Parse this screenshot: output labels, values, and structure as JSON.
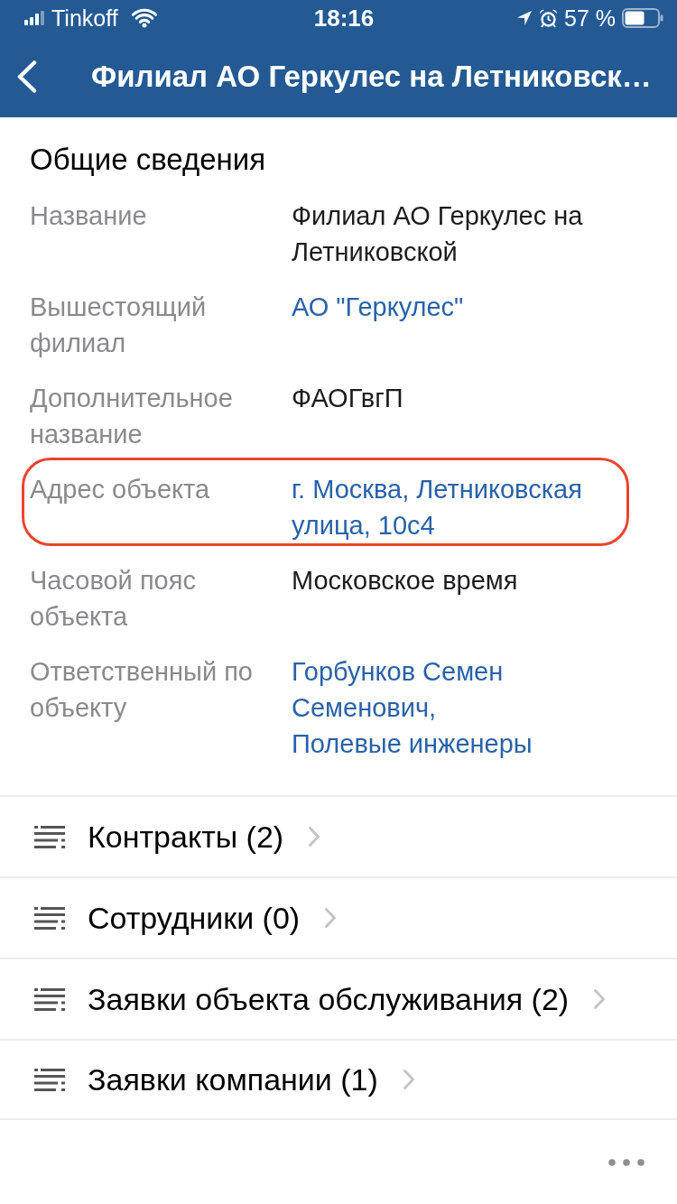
{
  "status_bar": {
    "carrier": "Tinkoff",
    "time": "18:16",
    "battery": "57 %"
  },
  "nav_bar": {
    "title": "Филиал АО Геркулес на Летниковск…"
  },
  "general_info": {
    "title": "Общие сведения",
    "fields": [
      {
        "label": "Название",
        "highlighted": false,
        "values": [
          {
            "kind": "text",
            "text": "Филиал АО Геркулес на Летниковской"
          }
        ]
      },
      {
        "label": "Вышестоящий филиал",
        "highlighted": false,
        "values": [
          {
            "kind": "link",
            "text": "АО \"Геркулес\""
          }
        ]
      },
      {
        "label": "Дополнительное название",
        "highlighted": false,
        "values": [
          {
            "kind": "text",
            "text": "ФАОГвгП"
          }
        ]
      },
      {
        "label": "Адрес объекта",
        "highlighted": true,
        "values": [
          {
            "kind": "link",
            "text": "г. Москва, Летниковская улица, 10с4"
          }
        ]
      },
      {
        "label": "Часовой пояс объекта",
        "highlighted": false,
        "values": [
          {
            "kind": "text",
            "text": "Московское время"
          }
        ]
      },
      {
        "label": "Ответственный по объекту",
        "highlighted": false,
        "values": [
          {
            "kind": "link",
            "text": "Горбунков Семен Семенович,"
          },
          {
            "kind": "link",
            "text": "Полевые инженеры"
          }
        ]
      }
    ]
  },
  "sections": [
    {
      "label": "Контракты (2)"
    },
    {
      "label": "Сотрудники (0)"
    },
    {
      "label": "Заявки объекта обслуживания (2)"
    },
    {
      "label": "Заявки компании (1)"
    }
  ]
}
